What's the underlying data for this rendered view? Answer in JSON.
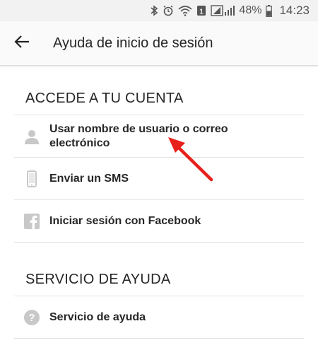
{
  "status_bar": {
    "battery": "48%",
    "time": "14:23",
    "icons": [
      "bluetooth-icon",
      "alarm-icon",
      "wifi-icon",
      "sim-1-icon",
      "signal-icon",
      "battery-icon"
    ]
  },
  "app_bar": {
    "title": "Ayuda de inicio de sesión",
    "back_icon": "arrow-left-icon"
  },
  "sections": [
    {
      "header": "ACCEDE A TU CUENTA",
      "items": [
        {
          "label": "Usar nombre de usuario o correo electrónico",
          "icon": "person-icon"
        },
        {
          "label": "Enviar un SMS",
          "icon": "phone-icon"
        },
        {
          "label": "Iniciar sesión con Facebook",
          "icon": "facebook-icon"
        }
      ]
    },
    {
      "header": "SERVICIO DE AYUDA",
      "items": [
        {
          "label": "Servicio de ayuda",
          "icon": "help-icon"
        }
      ]
    }
  ],
  "annotation": {
    "icon": "red-arrow-icon",
    "color": "#e8201a"
  },
  "colors": {
    "icon_gray": "#c8c8c8",
    "text": "#262626",
    "divider": "#e3e3e3"
  }
}
